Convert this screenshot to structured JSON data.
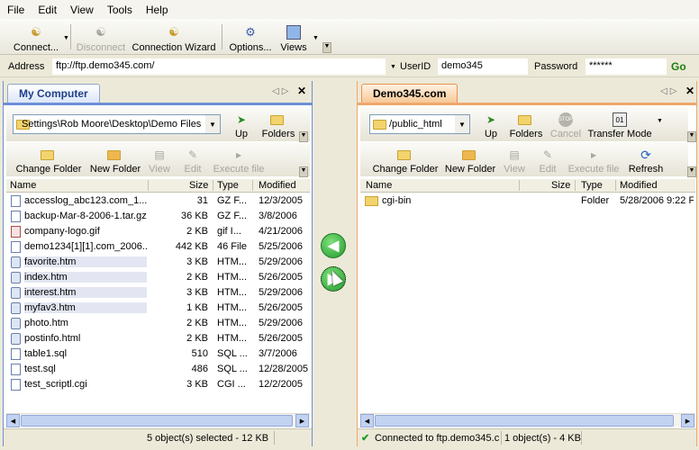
{
  "menu": [
    "File",
    "Edit",
    "View",
    "Tools",
    "Help"
  ],
  "toolbar": {
    "connect": "Connect...",
    "disconnect": "Disconnect",
    "wizard": "Connection Wizard",
    "options": "Options...",
    "views": "Views"
  },
  "address": {
    "label": "Address",
    "value": "ftp://ftp.demo345.com/",
    "userid_label": "UserID",
    "userid_value": "demo345",
    "password_label": "Password",
    "password_value": "******",
    "go_label": "Go"
  },
  "left": {
    "tab": "My Computer",
    "path": "Settings\\Rob Moore\\Desktop\\Demo Files",
    "up": "Up",
    "folders": "Folders",
    "change_folder": "Change Folder",
    "new_folder": "New Folder",
    "view": "View",
    "edit": "Edit",
    "execute": "Execute file",
    "columns": [
      "Name",
      "Size",
      "Type",
      "Modified"
    ],
    "files": [
      {
        "name": "accesslog_abc123.com_1...",
        "size": "31",
        "type": "GZ F...",
        "modified": "12/3/2005",
        "icon": "doc",
        "selected": false
      },
      {
        "name": "backup-Mar-8-2006-1.tar.gz",
        "size": "36 KB",
        "type": "GZ F...",
        "modified": "3/8/2006",
        "icon": "doc",
        "selected": false
      },
      {
        "name": "company-logo.gif",
        "size": "2 KB",
        "type": "gif I...",
        "modified": "4/21/2006",
        "icon": "gif",
        "selected": false
      },
      {
        "name": "demo1234[1][1].com_2006...",
        "size": "442 KB",
        "type": "46 File",
        "modified": "5/25/2006",
        "icon": "doc",
        "selected": false
      },
      {
        "name": "favorite.htm",
        "size": "3 KB",
        "type": "HTM...",
        "modified": "5/29/2006",
        "icon": "htm",
        "selected": true
      },
      {
        "name": "index.htm",
        "size": "2 KB",
        "type": "HTM...",
        "modified": "5/26/2005",
        "icon": "htm",
        "selected": true
      },
      {
        "name": "interest.htm",
        "size": "3 KB",
        "type": "HTM...",
        "modified": "5/29/2006",
        "icon": "htm",
        "selected": true
      },
      {
        "name": "myfav3.htm",
        "size": "1 KB",
        "type": "HTM...",
        "modified": "5/26/2005",
        "icon": "htm",
        "selected": true
      },
      {
        "name": "photo.htm",
        "size": "2 KB",
        "type": "HTM...",
        "modified": "5/29/2006",
        "icon": "htm",
        "selected": false
      },
      {
        "name": "postinfo.html",
        "size": "2 KB",
        "type": "HTM...",
        "modified": "5/26/2005",
        "icon": "htm",
        "selected": false
      },
      {
        "name": "table1.sql",
        "size": "510",
        "type": "SQL ...",
        "modified": "3/7/2006",
        "icon": "doc",
        "selected": false
      },
      {
        "name": "test.sql",
        "size": "486",
        "type": "SQL ...",
        "modified": "12/28/2005",
        "icon": "doc",
        "selected": false
      },
      {
        "name": "test_scriptl.cgi",
        "size": "3 KB",
        "type": "CGI ...",
        "modified": "12/2/2005",
        "icon": "doc",
        "selected": false
      }
    ],
    "status": "5 object(s) selected - 12 KB"
  },
  "right": {
    "tab": "Demo345.com",
    "path": "/public_html",
    "up": "Up",
    "folders": "Folders",
    "cancel": "Cancel",
    "transfer_mode": "Transfer Mode",
    "change_folder": "Change Folder",
    "new_folder": "New Folder",
    "view": "View",
    "edit": "Edit",
    "execute": "Execute file",
    "refresh": "Refresh",
    "columns": [
      "Name",
      "Size",
      "Type",
      "Modified"
    ],
    "files": [
      {
        "name": "cgi-bin",
        "size": "",
        "type": "Folder",
        "modified": "5/28/2006 9:22 F",
        "icon": "fold",
        "selected": false
      }
    ],
    "status_connected": "Connected to ftp.demo345.c",
    "status_count": "1 object(s) - 4 KB"
  },
  "colors": {
    "left_accent": "#6d8fd6",
    "right_accent": "#f0a76a",
    "selection": "#e3e6f2",
    "arrow_green": "#2aa63a"
  }
}
